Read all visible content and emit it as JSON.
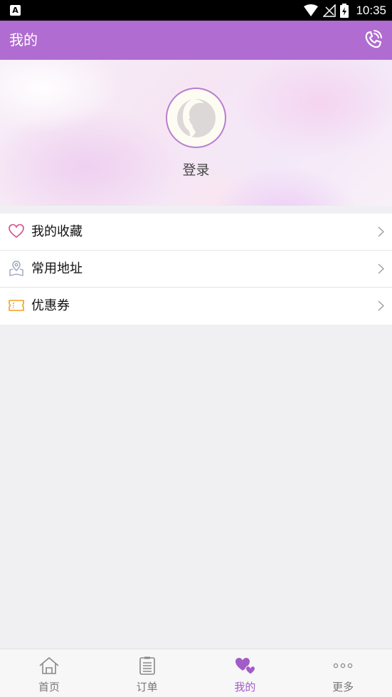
{
  "status_bar": {
    "time": "10:35",
    "notification_icon": "a-icon",
    "icons": [
      "wifi-icon",
      "signal-icon",
      "battery-icon"
    ]
  },
  "app_bar": {
    "title": "我的",
    "action_icon": "phone-icon"
  },
  "profile": {
    "login_label": "登录",
    "avatar_icon": "avatar-icon"
  },
  "menu": {
    "items": [
      {
        "label": "我的收藏",
        "icon": "heart-icon",
        "icon_color": "#d64a8c"
      },
      {
        "label": "常用地址",
        "icon": "location-icon",
        "icon_color": "#9aa3b8"
      },
      {
        "label": "优惠券",
        "icon": "coupon-icon",
        "icon_color": "#f0a020"
      }
    ]
  },
  "tab_bar": {
    "active": "我的",
    "active_color": "#a35bc7",
    "tabs": [
      {
        "label": "首页",
        "icon": "home-icon"
      },
      {
        "label": "订单",
        "icon": "order-icon"
      },
      {
        "label": "我的",
        "icon": "hearts-icon"
      },
      {
        "label": "更多",
        "icon": "more-icon"
      }
    ]
  },
  "colors": {
    "app_bar": "#b06cd0",
    "background": "#f0f0f2"
  }
}
